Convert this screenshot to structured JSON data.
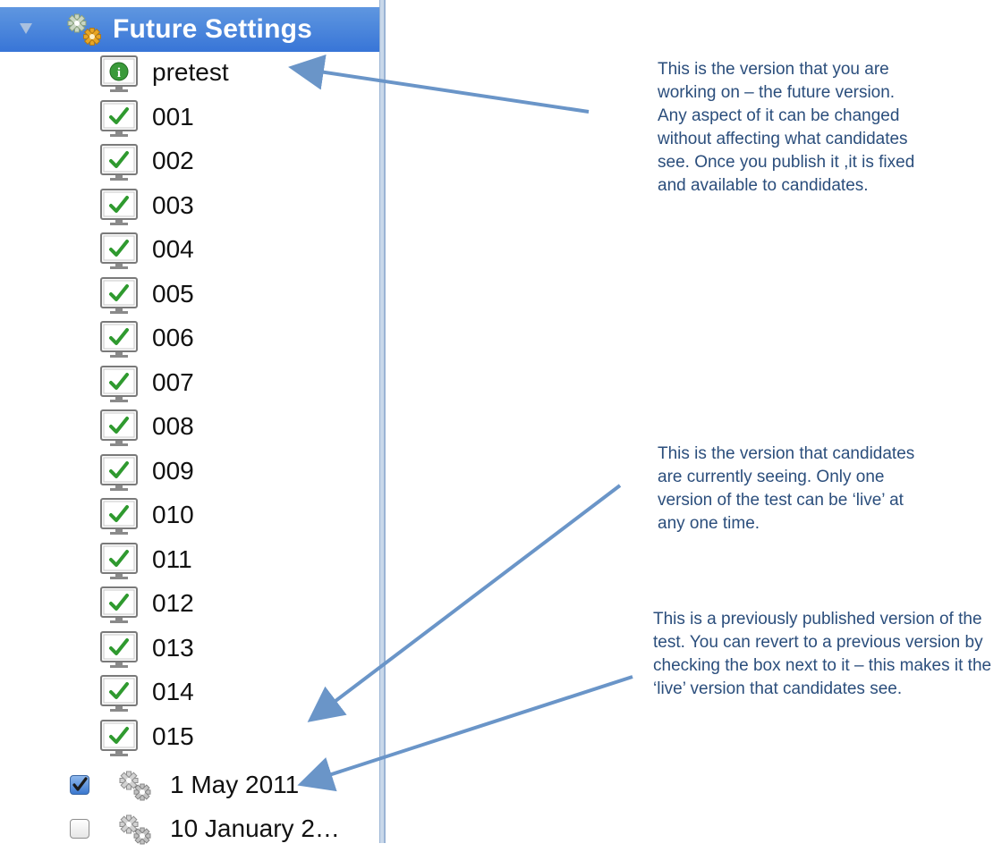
{
  "tree": {
    "header": {
      "title": "Future Settings",
      "icon": "gears-icon",
      "expanded": true
    },
    "pages": [
      {
        "label": "pretest",
        "icon": "info-page-icon"
      },
      {
        "label": "001",
        "icon": "check-page-icon"
      },
      {
        "label": "002",
        "icon": "check-page-icon"
      },
      {
        "label": "003",
        "icon": "check-page-icon"
      },
      {
        "label": "004",
        "icon": "check-page-icon"
      },
      {
        "label": "005",
        "icon": "check-page-icon"
      },
      {
        "label": "006",
        "icon": "check-page-icon"
      },
      {
        "label": "007",
        "icon": "check-page-icon"
      },
      {
        "label": "008",
        "icon": "check-page-icon"
      },
      {
        "label": "009",
        "icon": "check-page-icon"
      },
      {
        "label": "010",
        "icon": "check-page-icon"
      },
      {
        "label": "011",
        "icon": "check-page-icon"
      },
      {
        "label": "012",
        "icon": "check-page-icon"
      },
      {
        "label": "013",
        "icon": "check-page-icon"
      },
      {
        "label": "014",
        "icon": "check-page-icon"
      },
      {
        "label": "015",
        "icon": "check-page-icon"
      }
    ],
    "versions": [
      {
        "label": "1 May 2011",
        "checked": true
      },
      {
        "label": "10 January 2…",
        "checked": false
      }
    ]
  },
  "callouts": {
    "future": "This is the version that you are working on – the future version. Any aspect of it can be changed without affecting what candidates see. Once you publish it ,it is fixed and available to candidates.",
    "live": "This is the version that candidates are currently seeing. Only one version of the test can be ‘live’ at any one time.",
    "previous": "This is a previously published version of the test. You can revert to a previous version by checking the box next to it – this makes it the ‘live’ version that candidates see."
  },
  "colors": {
    "selection": "#3875d7",
    "callout_text": "#2b4e7c",
    "arrow": "#6a95c8",
    "check_green": "#2f9a2f",
    "info_green": "#3a9a3a"
  }
}
